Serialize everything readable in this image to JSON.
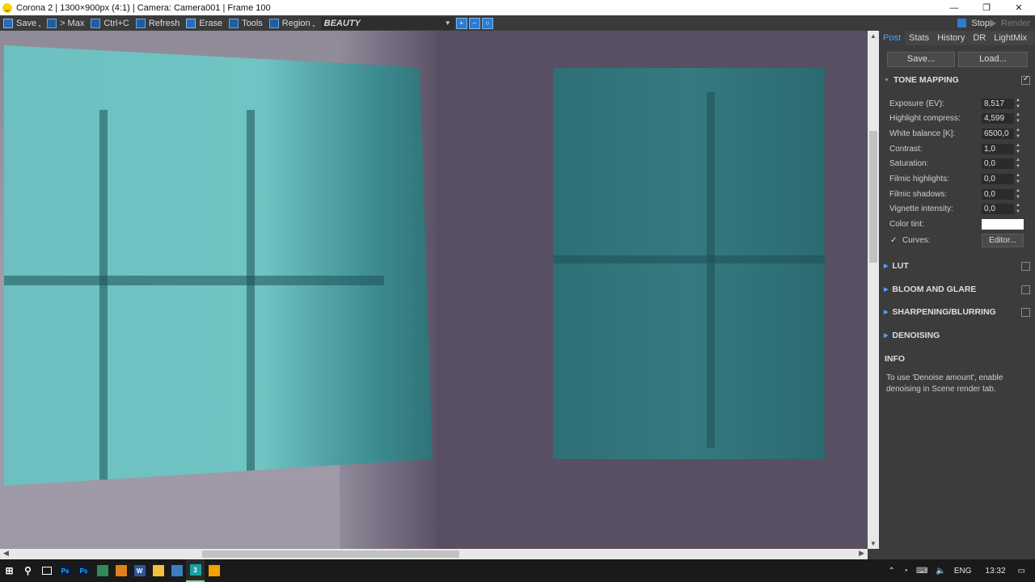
{
  "titlebar": {
    "title": "Corona 2 | 1300×900px (4:1) | Camera: Camera001 | Frame 100",
    "minimize": "—",
    "maximize": "❐",
    "close": "✕"
  },
  "toolbar": {
    "save": "Save",
    "max": "> Max",
    "copy": "Ctrl+C",
    "refresh": "Refresh",
    "erase": "Erase",
    "tools": "Tools",
    "region": "Region",
    "pass": "BEAUTY",
    "stop": "Stop",
    "render": "Render"
  },
  "panel": {
    "tabs": [
      "Post",
      "Stats",
      "History",
      "DR",
      "LightMix"
    ],
    "active_tab": "Post",
    "save_btn": "Save...",
    "load_btn": "Load...",
    "tone_mapping": {
      "title": "TONE MAPPING",
      "enabled": true,
      "rows": [
        {
          "label": "Exposure (EV):",
          "value": "8,517"
        },
        {
          "label": "Highlight compress:",
          "value": "4,599"
        },
        {
          "label": "White balance [K]:",
          "value": "6500,0"
        },
        {
          "label": "Contrast:",
          "value": "1,0"
        },
        {
          "label": "Saturation:",
          "value": "0,0"
        },
        {
          "label": "Filmic highlights:",
          "value": "0,0"
        },
        {
          "label": "Filmic shadows:",
          "value": "0,0"
        },
        {
          "label": "Vignette intensity:",
          "value": "0,0"
        }
      ],
      "color_tint_label": "Color tint:",
      "color_tint_value": "#ffffff",
      "curves_label": "Curves:",
      "curves_enabled": true,
      "editor_btn": "Editor..."
    },
    "sections": [
      "LUT",
      "BLOOM AND GLARE",
      "SHARPENING/BLURRING",
      "DENOISING"
    ],
    "info_title": "INFO",
    "info_text": "To use 'Denoise amount', enable denoising in Scene render tab."
  },
  "taskbar": {
    "tray_lang": "ENG",
    "clock": "13:32"
  },
  "colors": {
    "accent": "#4da3ff",
    "panel_bg": "#3c3c3c",
    "toolbar_bg": "#3b3b3b",
    "window_glass": "#6cc0c0"
  }
}
